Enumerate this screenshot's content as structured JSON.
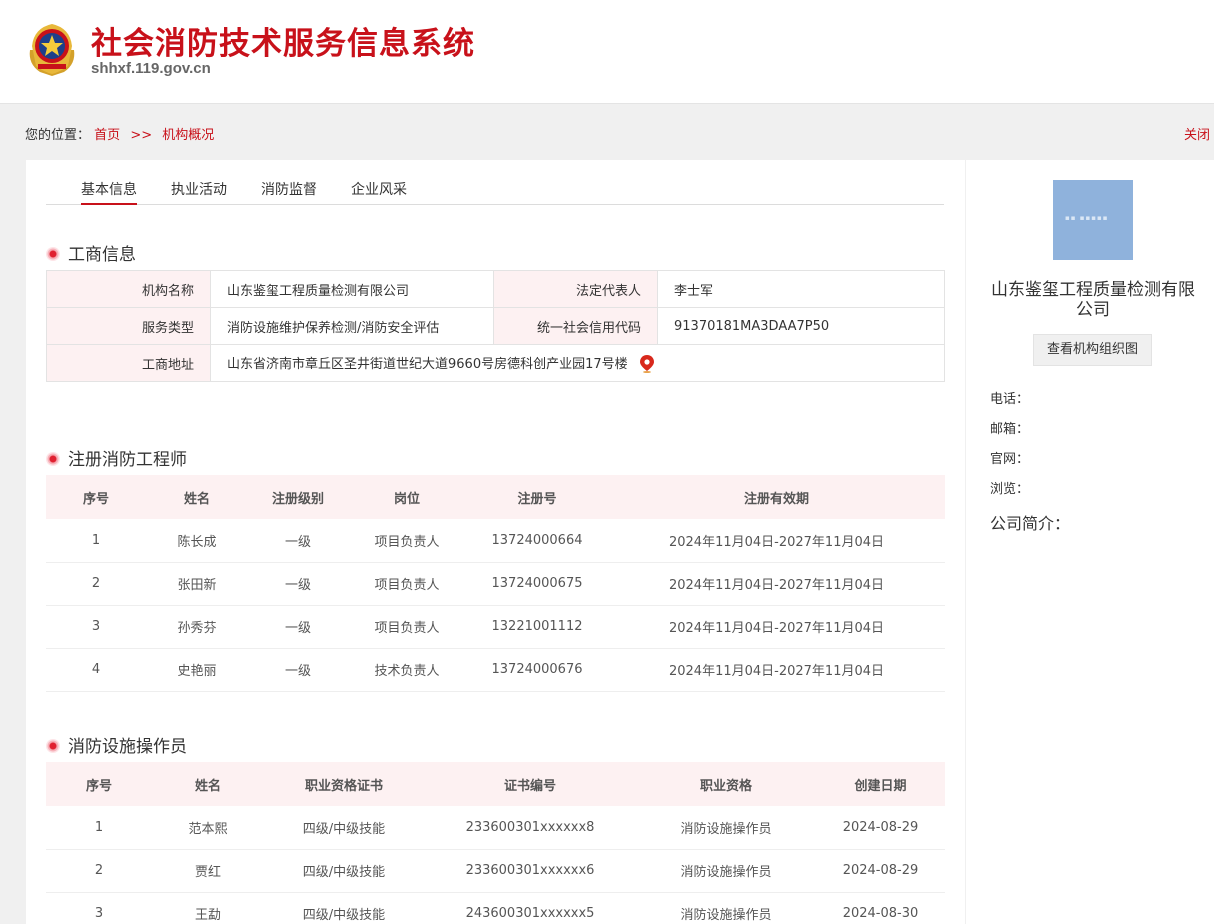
{
  "header": {
    "title": "社会消防技术服务信息系统",
    "domain": "shhxf.119.gov.cn"
  },
  "breadcrumb": {
    "label": "您的位置：",
    "home": "首页",
    "sep": ">>",
    "current": "机构概况",
    "close": "关闭"
  },
  "tabs": [
    "基本信息",
    "执业活动",
    "消防监督",
    "企业风采"
  ],
  "business": {
    "title": "工商信息",
    "name_label": "机构名称",
    "name": "山东鉴玺工程质量检测有限公司",
    "legal_label": "法定代表人",
    "legal": "李士军",
    "service_label": "服务类型",
    "service": "消防设施维护保养检测/消防安全评估",
    "credit_label": "统一社会信用代码",
    "credit": "91370181MA3DAA7P50",
    "address_label": "工商地址",
    "address": "山东省济南市章丘区圣井街道世纪大道9660号房德科创产业园17号楼"
  },
  "engineers": {
    "title": "注册消防工程师",
    "headers": [
      "序号",
      "姓名",
      "注册级别",
      "岗位",
      "注册号",
      "注册有效期"
    ],
    "rows": [
      [
        "1",
        "陈长成",
        "一级",
        "项目负责人",
        "13724000664",
        "2024年11月04日-2027年11月04日"
      ],
      [
        "2",
        "张田新",
        "一级",
        "项目负责人",
        "13724000675",
        "2024年11月04日-2027年11月04日"
      ],
      [
        "3",
        "孙秀芬",
        "一级",
        "项目负责人",
        "13221001112",
        "2024年11月04日-2027年11月04日"
      ],
      [
        "4",
        "史艳丽",
        "一级",
        "技术负责人",
        "13724000676",
        "2024年11月04日-2027年11月04日"
      ]
    ]
  },
  "operators": {
    "title": "消防设施操作员",
    "headers": [
      "序号",
      "姓名",
      "职业资格证书",
      "证书编号",
      "职业资格",
      "创建日期"
    ],
    "rows": [
      [
        "1",
        "范本熙",
        "四级/中级技能",
        "233600301xxxxxx8",
        "消防设施操作员",
        "2024-08-29"
      ],
      [
        "2",
        "贾红",
        "四级/中级技能",
        "233600301xxxxxx6",
        "消防设施操作员",
        "2024-08-29"
      ],
      [
        "3",
        "王勐",
        "四级/中级技能",
        "243600301xxxxxx5",
        "消防设施操作员",
        "2024-08-30"
      ]
    ]
  },
  "sidebar": {
    "company_name": "山东鉴玺工程质量检测有限公司",
    "org_chart_button": "查看机构组织图",
    "phone_label": "电话：",
    "email_label": "邮箱：",
    "website_label": "官网：",
    "views_label": "浏览：",
    "intro_label": "公司简介："
  },
  "colors": {
    "accent": "#c8111a",
    "header_bg": "#fdf1f2"
  }
}
